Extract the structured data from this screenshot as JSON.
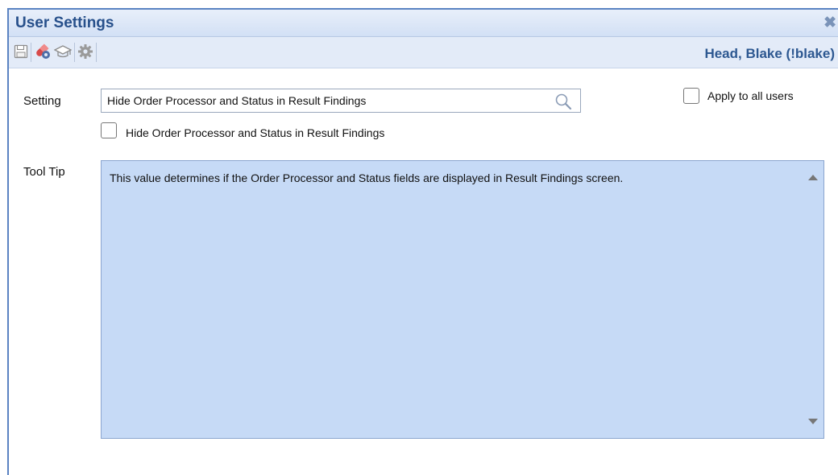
{
  "window": {
    "title": "User Settings",
    "close_icon": "close-icon"
  },
  "toolbar": {
    "buttons": [
      {
        "name": "save",
        "icon": "save-icon"
      },
      {
        "name": "medication",
        "icon": "pill-gear-icon"
      },
      {
        "name": "education",
        "icon": "graduation-cap-icon"
      },
      {
        "name": "settings",
        "icon": "gear-icon"
      }
    ],
    "user_name": "Head, Blake (!blake)"
  },
  "form": {
    "setting_label": "Setting",
    "setting_value": "Hide Order Processor and Status in Result Findings",
    "apply_all_label": "Apply to all users",
    "apply_all_checked": false,
    "value_checkbox_label": "Hide Order Processor and Status in Result Findings",
    "value_checked": false,
    "tooltip_label": "Tool Tip",
    "tooltip_text": "This value determines if the Order Processor and Status fields are displayed in Result Findings screen."
  },
  "colors": {
    "title": "#27508b",
    "toolbar_bg": "#e3ebf8",
    "tooltip_bg": "#c6daf6",
    "window_border": "#5a83c2"
  }
}
